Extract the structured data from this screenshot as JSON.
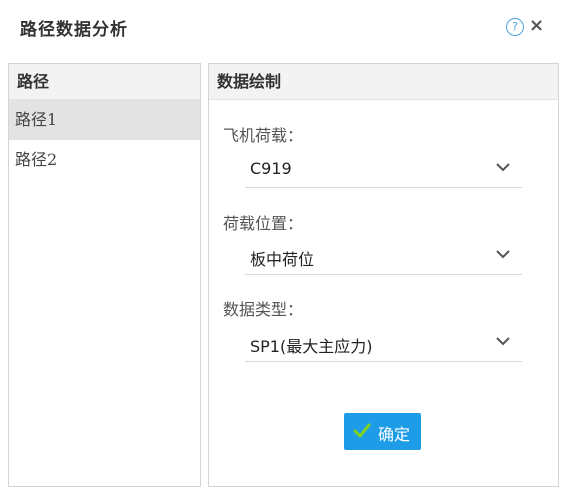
{
  "dialog": {
    "title": "路径数据分析",
    "help_icon": "?",
    "close_icon": "×"
  },
  "paths_panel": {
    "header": "路径",
    "items": [
      {
        "label": "路径1",
        "selected": true
      },
      {
        "label": "路径2",
        "selected": false
      }
    ]
  },
  "plot_panel": {
    "header": "数据绘制",
    "aircraft_load": {
      "label": "飞机荷载：",
      "value": "C919"
    },
    "load_position": {
      "label": "荷载位置：",
      "value": "板中荷位"
    },
    "data_type": {
      "label": "数据类型：",
      "value": "SP1(最大主应力)"
    },
    "confirm_label": "确定"
  },
  "colors": {
    "accent": "#1e9ce8",
    "help": "#4aa3df",
    "check": "#7ed321",
    "selected_row": "#e3e3e3"
  }
}
